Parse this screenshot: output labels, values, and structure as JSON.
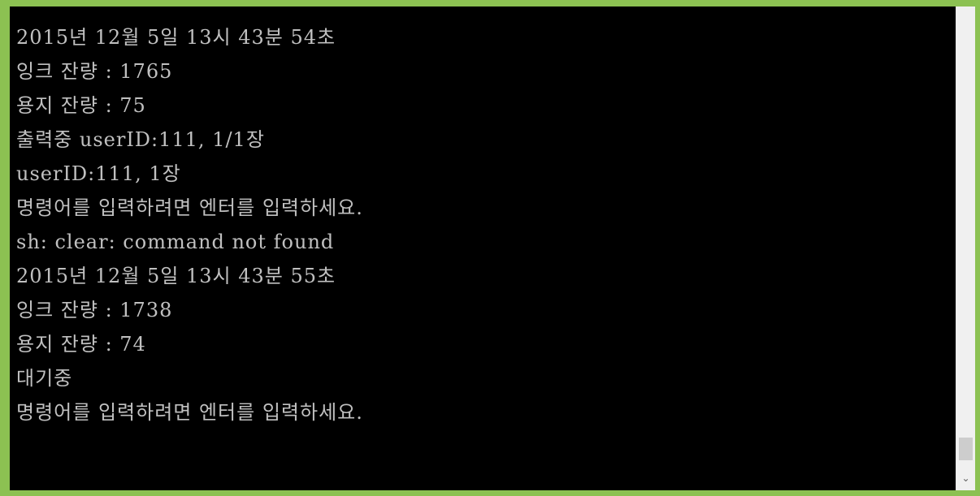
{
  "console": {
    "lines": [
      "2015년 12월 5일 13시 43분 54초",
      "잉크 잔량 : 1765",
      "용지 잔량 : 75",
      "출력중 userID:111, 1/1장",
      "userID:111, 1장",
      "명령어를 입력하려면 엔터를 입력하세요.",
      "sh: clear: command not found",
      "2015년 12월 5일 13시 43분 55초",
      "잉크 잔량 : 1738",
      "용지 잔량 : 74",
      "대기중",
      "명령어를 입력하려면 엔터를 입력하세요."
    ]
  },
  "scrollbar": {
    "down_arrow_icon": "chevron-down-icon",
    "down_arrow_glyph": "⌄"
  },
  "colors": {
    "frame": "#8cc152",
    "console_background": "#000000",
    "console_text": "#c0c0c0",
    "scrollbar_track": "#f0f0f0",
    "scrollbar_thumb": "#cdcdcd"
  }
}
